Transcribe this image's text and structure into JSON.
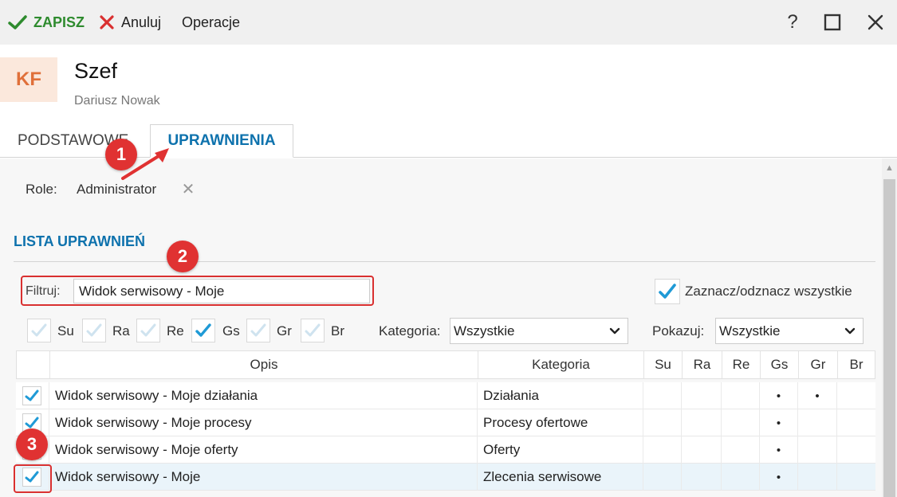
{
  "toolbar": {
    "save_label": "ZAPISZ",
    "cancel_label": "Anuluj",
    "operations_label": "Operacje",
    "help_label": "?"
  },
  "header": {
    "avatar_initials": "KF",
    "title": "Szef",
    "subtitle": "Dariusz Nowak"
  },
  "tabs": [
    {
      "label": "PODSTAWOWE",
      "active": false
    },
    {
      "label": "UPRAWNIENIA",
      "active": true
    }
  ],
  "roles": {
    "label": "Role:",
    "value": "Administrator"
  },
  "section": {
    "title": "LISTA UPRAWNIEŃ"
  },
  "filter": {
    "label": "Filtruj:",
    "value": "Widok serwisowy - Moje"
  },
  "select_all": {
    "label": "Zaznacz/odznacz wszystkie",
    "checked": true
  },
  "permission_toggles": [
    {
      "label": "Su",
      "checked": false
    },
    {
      "label": "Ra",
      "checked": false
    },
    {
      "label": "Re",
      "checked": false
    },
    {
      "label": "Gs",
      "checked": true
    },
    {
      "label": "Gr",
      "checked": false
    },
    {
      "label": "Br",
      "checked": false
    }
  ],
  "category_filter": {
    "label": "Kategoria:",
    "value": "Wszystkie"
  },
  "show_filter": {
    "label": "Pokazuj:",
    "value": "Wszystkie"
  },
  "grid": {
    "columns": [
      "Opis",
      "Kategoria",
      "Su",
      "Ra",
      "Re",
      "Gs",
      "Gr",
      "Br"
    ],
    "rows": [
      {
        "opis": "Widok serwisowy - Moje działania",
        "kategoria": "Działania",
        "Su": "",
        "Ra": "",
        "Re": "",
        "Gs": "•",
        "Gr": "•",
        "Br": ""
      },
      {
        "opis": "Widok serwisowy - Moje procesy",
        "kategoria": "Procesy ofertowe",
        "Su": "",
        "Ra": "",
        "Re": "",
        "Gs": "•",
        "Gr": "",
        "Br": ""
      },
      {
        "opis": "Widok serwisowy - Moje oferty",
        "kategoria": "Oferty",
        "Su": "",
        "Ra": "",
        "Re": "",
        "Gs": "•",
        "Gr": "",
        "Br": ""
      },
      {
        "opis": "Widok serwisowy - Moje",
        "kategoria": "Zlecenia serwisowe",
        "Su": "",
        "Ra": "",
        "Re": "",
        "Gs": "•",
        "Gr": "",
        "Br": ""
      }
    ]
  },
  "annotations": [
    "1",
    "2",
    "3"
  ],
  "colors": {
    "accent": "#0e72ad",
    "save_green": "#2e8b2e",
    "cancel_red": "#d93030",
    "check_blue": "#1f9ad6",
    "avatar_bg": "#fbe8dc",
    "avatar_text": "#e0703a",
    "annotation_red": "#e03232"
  }
}
